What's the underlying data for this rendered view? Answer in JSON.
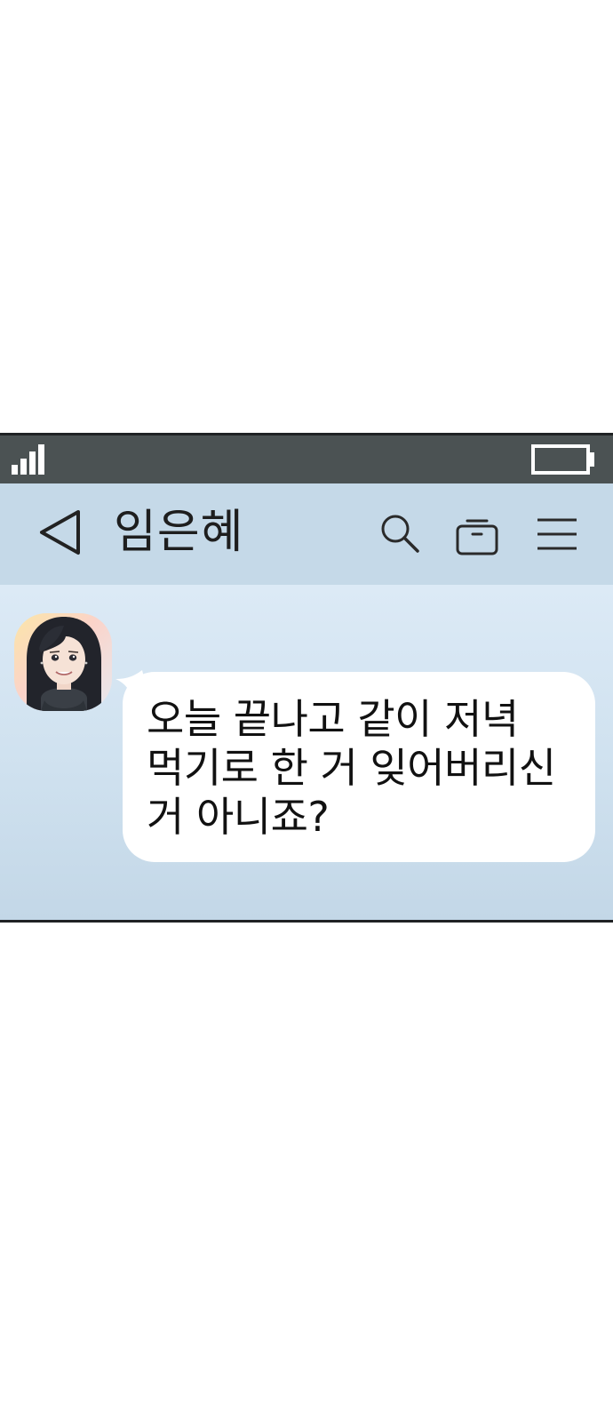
{
  "status_bar": {
    "signal_icon": "signal-bars-icon",
    "battery_icon": "battery-icon",
    "colors": {
      "background": "#4b5253",
      "foreground": "#ffffff"
    }
  },
  "header": {
    "contact_name": "임은혜",
    "back_icon": "back-triangle-icon",
    "search_icon": "search-icon",
    "bag_icon": "bag-icon",
    "menu_icon": "menu-icon",
    "colors": {
      "background": "#c5d9e8"
    }
  },
  "chat": {
    "colors": {
      "background_top": "#dceaf6",
      "background_bottom": "#c3d7e7",
      "bubble": "#ffffff"
    },
    "messages": [
      {
        "sender": "임은혜",
        "avatar_icon": "contact-avatar",
        "text": "오늘 끝나고 같이 저녁\n먹기로 한 거 잊어버리신\n거 아니죠?"
      }
    ]
  }
}
